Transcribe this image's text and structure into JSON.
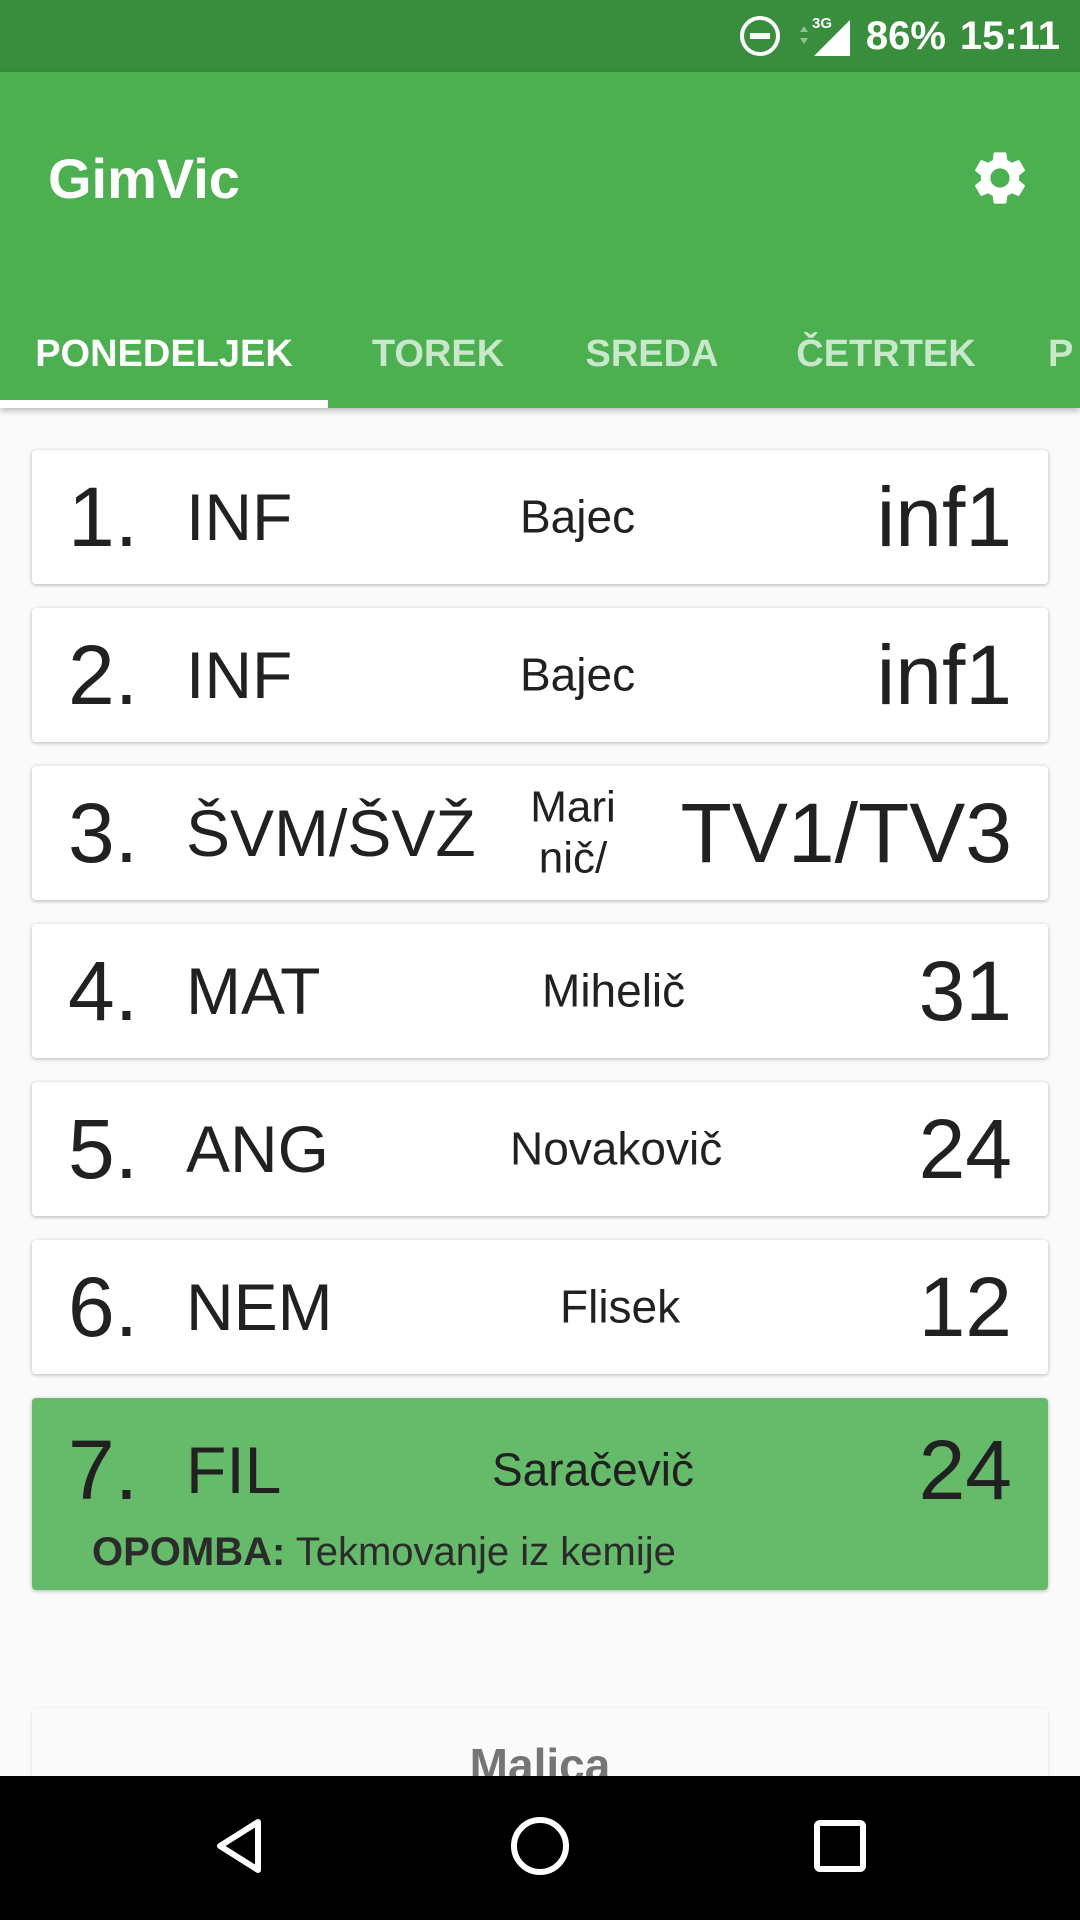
{
  "status_bar": {
    "battery": "86%",
    "time": "15:11",
    "network": "3G"
  },
  "app_bar": {
    "title": "GimVic",
    "settings_icon": "gear-icon"
  },
  "tabs": [
    {
      "label": "PONEDELJEK",
      "active": true
    },
    {
      "label": "TOREK",
      "active": false
    },
    {
      "label": "SREDA",
      "active": false
    },
    {
      "label": "ČETRTEK",
      "active": false
    },
    {
      "label": "P",
      "active": false
    }
  ],
  "schedule": [
    {
      "period": "1.",
      "subject": "INF",
      "teacher": "Bajec",
      "room": "inf1"
    },
    {
      "period": "2.",
      "subject": "INF",
      "teacher": "Bajec",
      "room": "inf1"
    },
    {
      "period": "3.",
      "subject": "ŠVM/ŠVŽ",
      "teacher": "Mari nič/",
      "room": "TV1/TV3"
    },
    {
      "period": "4.",
      "subject": "MAT",
      "teacher": "Mihelič",
      "room": "31"
    },
    {
      "period": "5.",
      "subject": "ANG",
      "teacher": "Novakovič",
      "room": "24"
    },
    {
      "period": "6.",
      "subject": "NEM",
      "teacher": "Flisek",
      "room": "12"
    },
    {
      "period": "7.",
      "subject": "FIL",
      "teacher": "Saračevič",
      "room": "24",
      "note_label": "OPOMBA:",
      "note_text": "Tekmovanje iz kemije",
      "highlighted": true
    }
  ],
  "snack": {
    "title": "Malica"
  },
  "colors": {
    "primary": "#4caf50",
    "primary_dark": "#388e3c",
    "highlight": "#66bb6a",
    "background": "#fafafa"
  },
  "nav_bar": {
    "back_icon": "back-triangle-icon",
    "home_icon": "home-circle-icon",
    "recents_icon": "recents-square-icon"
  }
}
